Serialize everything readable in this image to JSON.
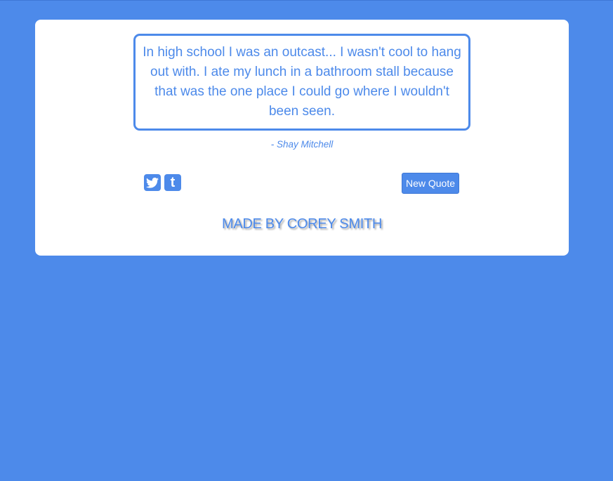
{
  "quote": {
    "text": "In high school I was an outcast... I wasn't cool to hang out with. I ate my lunch in a bathroom stall because that was the one place I could go where I wouldn't been seen.",
    "author": "- Shay Mitchell"
  },
  "actions": {
    "twitter_icon": "twitter-icon",
    "tumblr_icon": "tumblr-icon",
    "tumblr_glyph": "t",
    "new_quote_label": "New Quote"
  },
  "footer": {
    "credit": "MADE BY COREY SMITH"
  },
  "colors": {
    "background": "#4d8aea",
    "card": "#ffffff",
    "accent": "#4d8aea"
  }
}
